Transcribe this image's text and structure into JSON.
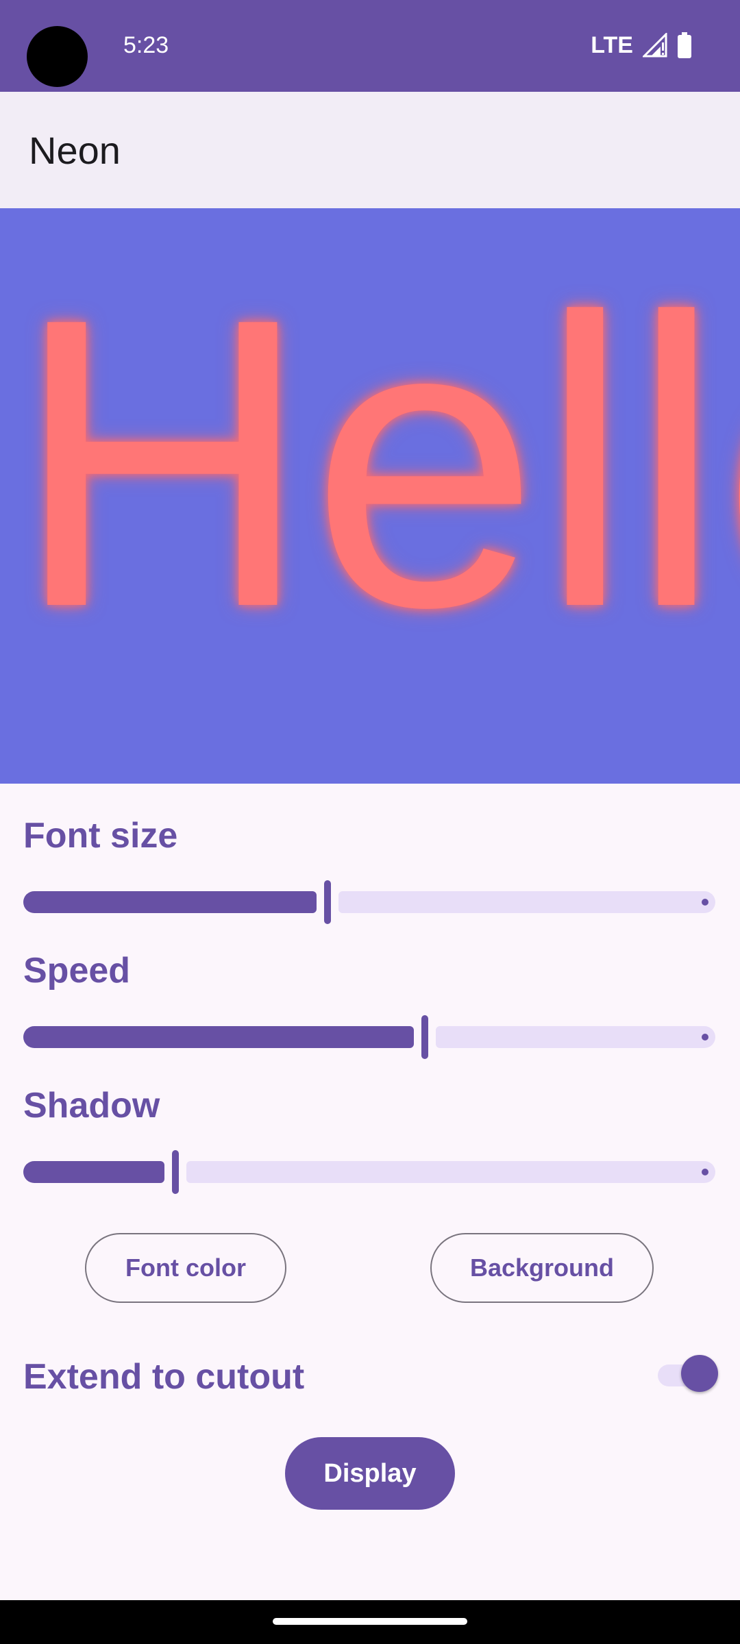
{
  "status_bar": {
    "time": "5:23",
    "network": "LTE",
    "icons": [
      "signal-icon",
      "battery-icon"
    ]
  },
  "app_bar": {
    "title": "Neon"
  },
  "preview": {
    "text": "Hello",
    "background_color": "#6A6FE0",
    "font_color": "#FF7676"
  },
  "controls": {
    "font_size": {
      "label": "Font size",
      "value": 0.44
    },
    "speed": {
      "label": "Speed",
      "value": 0.58
    },
    "shadow": {
      "label": "Shadow",
      "value": 0.22
    }
  },
  "buttons": {
    "font_color": "Font color",
    "background": "Background",
    "display": "Display"
  },
  "extend_to_cutout": {
    "label": "Extend to cutout",
    "enabled": true
  },
  "colors": {
    "primary": "#6750A4",
    "status_bar": "#6750A4",
    "app_bar": "#F2EDF6",
    "surface": "#FCF6FC",
    "track_inactive": "#E8DEF8"
  }
}
